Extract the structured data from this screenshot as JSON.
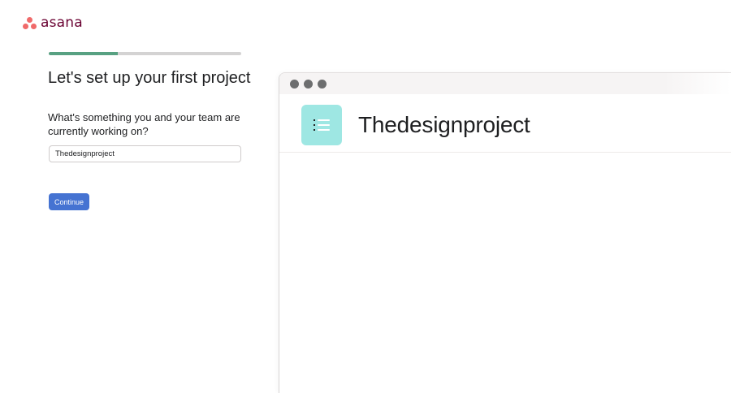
{
  "brand": {
    "name": "asana",
    "logo_color": "#f06a6a",
    "text_color": "#690031"
  },
  "onboarding": {
    "progress_percent": 36,
    "headline": "Let's set up your first project",
    "question": "What's something you and your team are currently working on?",
    "project_name_value": "Thedesignproject",
    "continue_label": "Continue"
  },
  "preview": {
    "project_icon": "list-icon",
    "project_icon_color": "#9ee7e3",
    "project_title": "Thedesignproject"
  },
  "colors": {
    "progress_fill": "#58a182",
    "progress_track": "#d4d3d3",
    "primary_button": "#4573d2"
  }
}
